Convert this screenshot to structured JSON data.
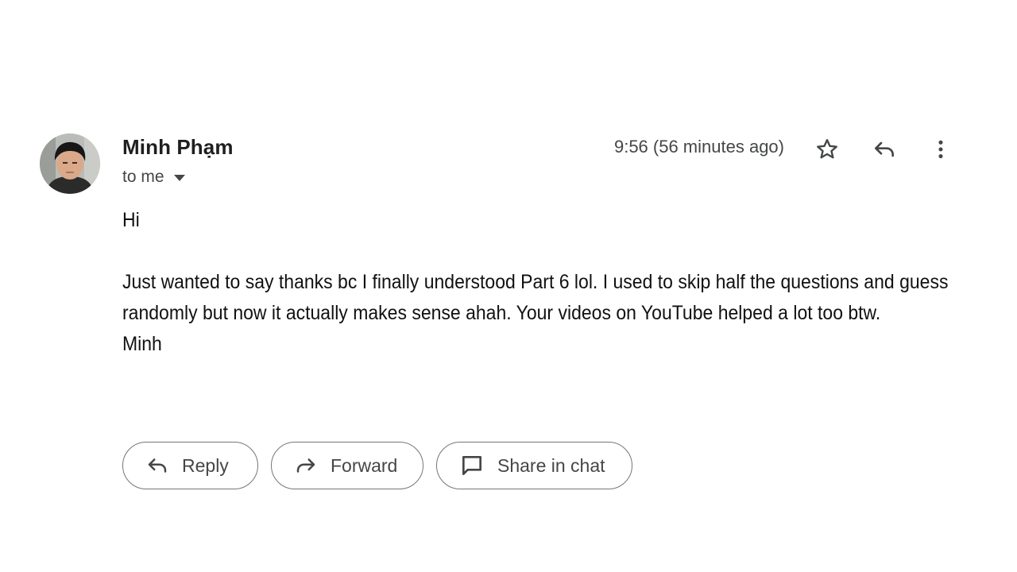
{
  "message": {
    "sender_name": "Minh Phạm",
    "recipient_label": "to me",
    "timestamp": "9:56 (56 minutes ago)",
    "body": {
      "greeting": "Hi",
      "paragraph": "Just wanted to say thanks bc I finally understood Part 6 lol. I used to skip half the questions and guess randomly but now it actually makes sense ahah. Your videos on YouTube helped a lot too btw.",
      "signoff": "Minh"
    }
  },
  "header_icons": {
    "star": "star-icon",
    "reply": "reply-icon",
    "more": "more-vert-icon"
  },
  "actions": {
    "reply_label": "Reply",
    "forward_label": "Forward",
    "share_label": "Share in chat"
  },
  "colors": {
    "text_primary": "#1f1f1f",
    "text_secondary": "#444746",
    "button_border": "#747775"
  }
}
